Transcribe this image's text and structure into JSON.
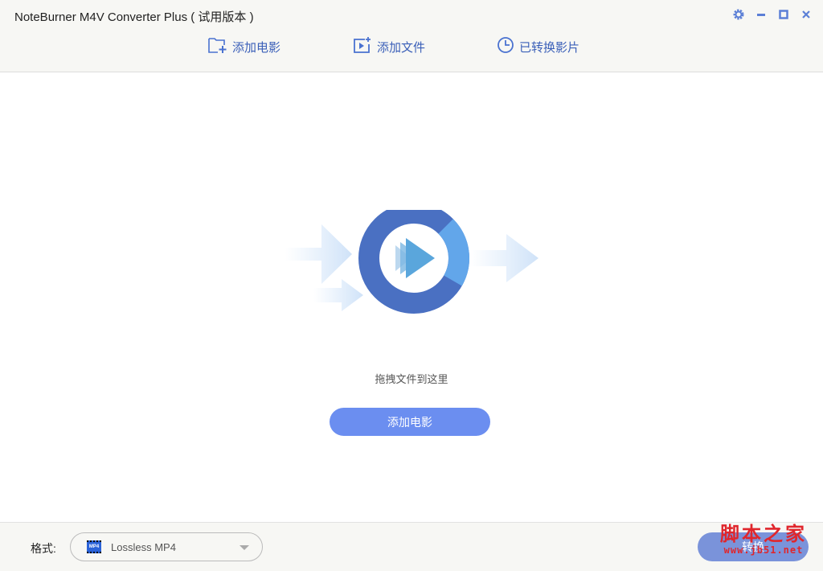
{
  "window": {
    "title": "NoteBurner M4V Converter Plus ( 试用版本 )"
  },
  "toolbar": {
    "add_movie": "添加电影",
    "add_file": "添加文件",
    "converted": "已转换影片"
  },
  "main": {
    "drop_hint": "拖拽文件到这里",
    "add_movie_button": "添加电影"
  },
  "footer": {
    "format_label": "格式:",
    "format_value": "Lossless MP4",
    "format_icon_text": "MP4",
    "convert_button": "转换"
  },
  "watermark": {
    "line1": "脚本之家",
    "line2": "www.jb51.net"
  },
  "colors": {
    "accent": "#6b8ef0",
    "icon": "#3a5fb8"
  }
}
